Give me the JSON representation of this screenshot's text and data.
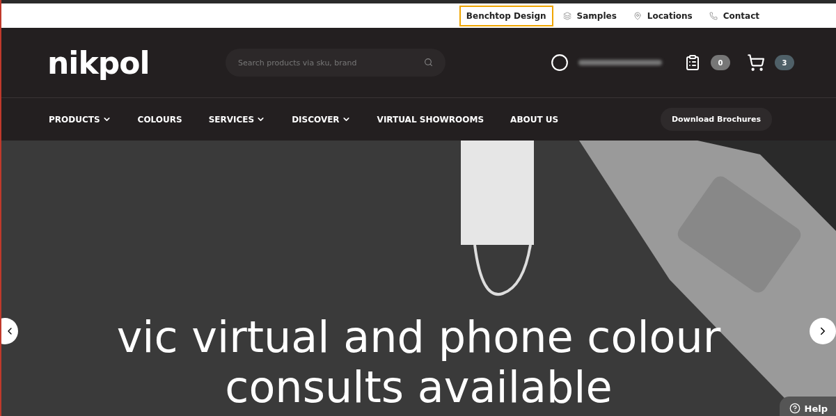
{
  "top_links": [
    {
      "label": "Benchtop Design",
      "highlighted": true
    },
    {
      "label": "Samples",
      "highlighted": false
    },
    {
      "label": "Locations",
      "highlighted": false
    },
    {
      "label": "Contact",
      "highlighted": false
    }
  ],
  "header": {
    "logo": "nikpol",
    "search": {
      "placeholder": "Search products via sku, brand"
    },
    "quote_count": "0",
    "cart_count": "3"
  },
  "nav": {
    "items": [
      {
        "label": "PRODUCTS",
        "dropdown": true
      },
      {
        "label": "COLOURS",
        "dropdown": false
      },
      {
        "label": "SERVICES",
        "dropdown": true
      },
      {
        "label": "DISCOVER",
        "dropdown": true
      },
      {
        "label": "VIRTUAL SHOWROOMS",
        "dropdown": false
      },
      {
        "label": "ABOUT US",
        "dropdown": false
      }
    ],
    "button": "Download Brochures"
  },
  "hero": {
    "headline": [
      "vic virtual and phone colour",
      "consults available"
    ]
  },
  "help": {
    "label": "Help"
  }
}
